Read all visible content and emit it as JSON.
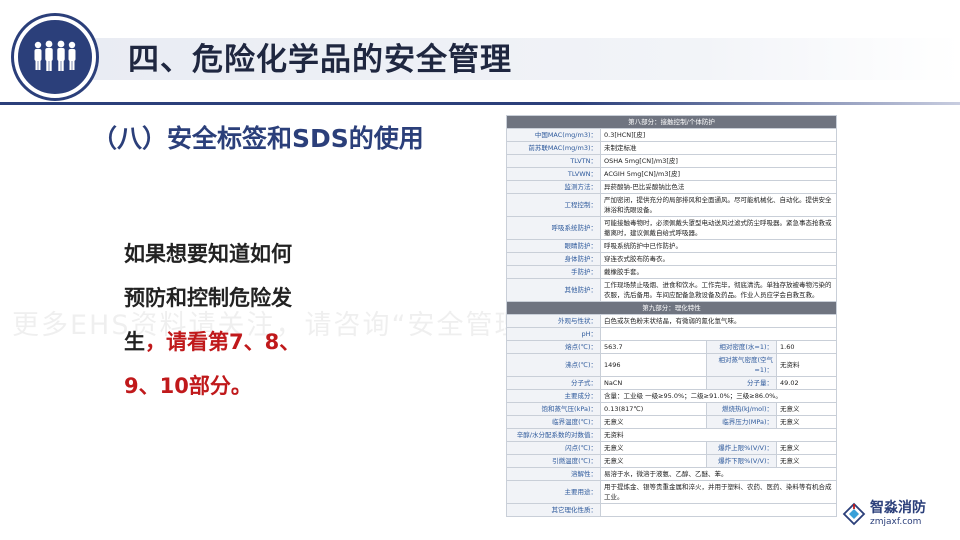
{
  "header": {
    "title": "四、危险化学品的安全管理"
  },
  "section": {
    "subtitle": "（八）安全标签和SDS的使用"
  },
  "body": {
    "line1": "如果想要知道如何",
    "line2": "预防和控制危险发",
    "line3_prefix": "生",
    "line3_red": "，请看第7、8、",
    "line4": "9、10部分。"
  },
  "watermark": {
    "text": "更多EHS资料请关注，请咨询“安全管理资料”：gjsj1"
  },
  "sds": {
    "part8_title": "第八部分：接触控制/个体防护",
    "part8_rows": [
      {
        "label": "中国MAC(mg/m3)：",
        "value": "0.3[HCN][皮]"
      },
      {
        "label": "前苏联MAC(mg/m3)：",
        "value": "未制定标准"
      },
      {
        "label": "TLVTN：",
        "value": "OSHA 5mg[CN]/m3[皮]"
      },
      {
        "label": "TLVWN：",
        "value": "ACGIH 5mg[CN]/m3[皮]"
      },
      {
        "label": "监测方法：",
        "value": "异菸酸钠-巴比妥酸钠比色法"
      },
      {
        "label": "工程控制：",
        "value": "严加密闭，提供充分的局部排风和全面通风。尽可能机械化、自动化。提供安全淋浴和洗眼设备。"
      },
      {
        "label": "呼吸系统防护：",
        "value": "可能接触毒物时，必须佩戴头罩型电动送风过滤式防尘呼吸器。紧急事态抢救或撤离时，建议佩戴自给式呼吸器。"
      },
      {
        "label": "眼睛防护：",
        "value": "呼吸系统防护中已作防护。"
      },
      {
        "label": "身体防护：",
        "value": "穿连衣式胶布防毒衣。"
      },
      {
        "label": "手防护：",
        "value": "戴橡胶手套。"
      },
      {
        "label": "其他防护：",
        "value": "工作现场禁止吸烟、进食和饮水。工作完毕，彻底清洗。单独存放被毒物污染的衣服，洗后备用。车间应配备急救设备及药品。作业人员应学会自救互救。"
      }
    ],
    "part9_title": "第九部分：理化特性",
    "part9_single": [
      {
        "label": "外观与性状：",
        "value": "白色或灰色粉末状结晶，有微弱的氰化氢气味。"
      },
      {
        "label": "pH：",
        "value": ""
      }
    ],
    "part9_pairs": [
      {
        "l1": "熔点(℃)：",
        "v1": "563.7",
        "l2": "相对密度(水=1)：",
        "v2": "1.60"
      },
      {
        "l1": "沸点(℃)：",
        "v1": "1496",
        "l2": "相对蒸气密度(空气=1)：",
        "v2": "无资料"
      },
      {
        "l1": "分子式：",
        "v1": "NaCN",
        "l2": "分子量：",
        "v2": "49.02"
      }
    ],
    "part9_mid": [
      {
        "label": "主要成分：",
        "value": "含量：工业级 一级≥95.0%；二级≥91.0%；三级≥86.0%。"
      }
    ],
    "part9_pairs2": [
      {
        "l1": "饱和蒸气压(kPa)：",
        "v1": "0.13(817℃)",
        "l2": "燃烧热(kJ/mol)：",
        "v2": "无意义"
      },
      {
        "l1": "临界温度(℃)：",
        "v1": "无意义",
        "l2": "临界压力(MPa)：",
        "v2": "无意义"
      }
    ],
    "part9_mid2": [
      {
        "label": "辛醇/水分配系数的对数值：",
        "value": "无资料"
      }
    ],
    "part9_pairs3": [
      {
        "l1": "闪点(℃)：",
        "v1": "无意义",
        "l2": "爆炸上限%(V/V)：",
        "v2": "无意义"
      },
      {
        "l1": "引燃温度(℃)：",
        "v1": "无意义",
        "l2": "爆炸下限%(V/V)：",
        "v2": "无意义"
      }
    ],
    "part9_tail": [
      {
        "label": "溶解性：",
        "value": "易溶于水，微溶于液氨、乙醇、乙醚、苯。"
      },
      {
        "label": "主要用途：",
        "value": "用于提炼金、银等贵重金属和淬火，并用于塑料、农药、医药、染料等有机合成工业。"
      },
      {
        "label": "其它理化性质：",
        "value": ""
      }
    ]
  },
  "brand": {
    "name": "智淼消防",
    "url": "zmjaxf.com"
  },
  "colors": {
    "primary": "#2b3f7a",
    "accent_red": "#c0191b",
    "table_header": "#6f7480"
  }
}
